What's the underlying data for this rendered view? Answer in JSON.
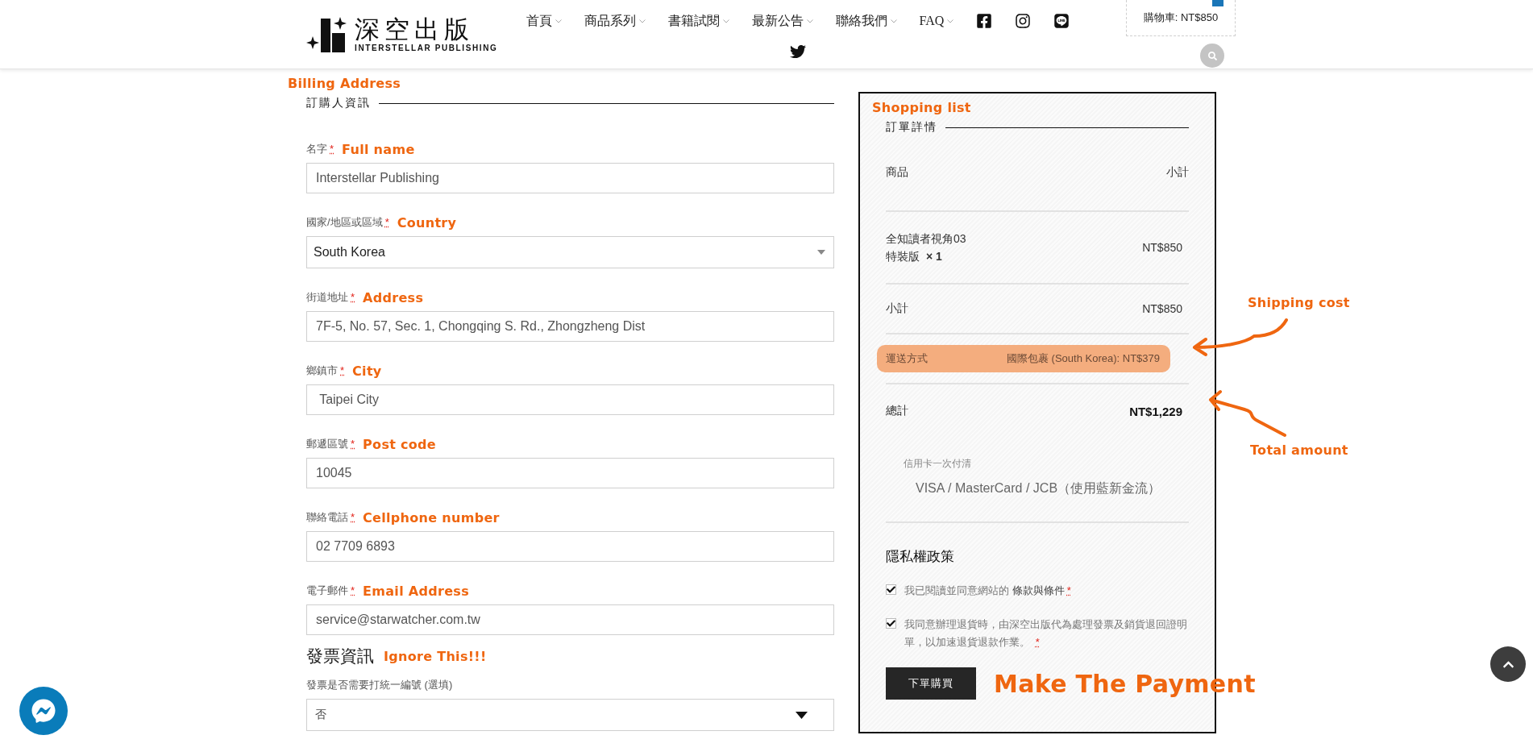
{
  "header": {
    "logo": {
      "title": "深空出版",
      "subtitle": "INTERSTELLAR PUBLISHING"
    },
    "nav": [
      "首頁",
      "商品系列",
      "書籍試閱",
      "最新公告",
      "聯絡我們",
      "FAQ"
    ],
    "social": [
      {
        "kind": "facebook"
      },
      {
        "kind": "instagram"
      },
      {
        "kind": "line"
      },
      {
        "kind": "twitter"
      }
    ],
    "cart": "購物車: NT$850"
  },
  "billing": {
    "annotation": "Billing Address",
    "title": "訂購人資訊",
    "fields": [
      {
        "label": "名字",
        "required_mark": "*",
        "annotation": "Full name",
        "kind": "text",
        "value": "Interstellar Publishing"
      },
      {
        "label": "國家/地區或區域",
        "required_mark": "*",
        "annotation": "Country",
        "kind": "select",
        "value": "South Korea"
      },
      {
        "label": "街道地址",
        "required_mark": "*",
        "annotation": "Address",
        "kind": "text",
        "value": "7F-5, No. 57, Sec. 1, Chongqing S. Rd., Zhongzheng Dist"
      },
      {
        "label": "鄉鎮市",
        "required_mark": "*",
        "annotation": "City",
        "kind": "text",
        "value": " Taipei City"
      },
      {
        "label": "郵遞區號",
        "required_mark": "*",
        "annotation": "Post code",
        "kind": "text",
        "value": "10045"
      },
      {
        "label": "聯絡電話",
        "required_mark": "*",
        "annotation": "Cellphone number",
        "kind": "text",
        "value": "02 7709 6893"
      },
      {
        "label": "電子郵件",
        "required_mark": "*",
        "annotation": "Email Address",
        "kind": "text",
        "value": "service@starwatcher.com.tw"
      }
    ]
  },
  "invoice": {
    "title": "發票資訊",
    "annotation": "Ignore This!!!",
    "fields": [
      {
        "label": "發票是否需要打統一編號 (選填)",
        "kind": "dropdown",
        "value": "否"
      }
    ]
  },
  "order": {
    "annotation": "Shopping list",
    "title": "訂單詳情",
    "head": {
      "product": "商品",
      "subtotal": "小計"
    },
    "items": [
      {
        "name": "全知讀者視角03特裝版",
        "qty": "× 1",
        "price": "NT$850"
      }
    ],
    "subtotal": {
      "label": "小計",
      "value": "NT$850"
    },
    "shipping": {
      "label": "運送方式",
      "value": "國際包裹 (South Korea): NT$379",
      "highlighted": true,
      "annotation": "Shipping cost"
    },
    "total": {
      "label": "總計",
      "value": "NT$1,229",
      "annotation": "Total amount"
    },
    "payment": {
      "title": "信用卡一次付清",
      "description": "VISA / MasterCard / JCB（使用藍新金流）"
    },
    "privacy": {
      "title": "隱私權政策",
      "checks": [
        {
          "text": "我已閱讀並同意網站的 ",
          "link": "條款與條件",
          "required_mark": "*",
          "checked": true
        },
        {
          "text": "我同意辦理退貨時，由深空出版代為處理發票及銷貨退回證明單，以加速退貨退款作業。 ",
          "required_mark": "*",
          "checked": true
        }
      ]
    },
    "submit": "下單購買",
    "submit_annotation": "Make The Payment"
  }
}
